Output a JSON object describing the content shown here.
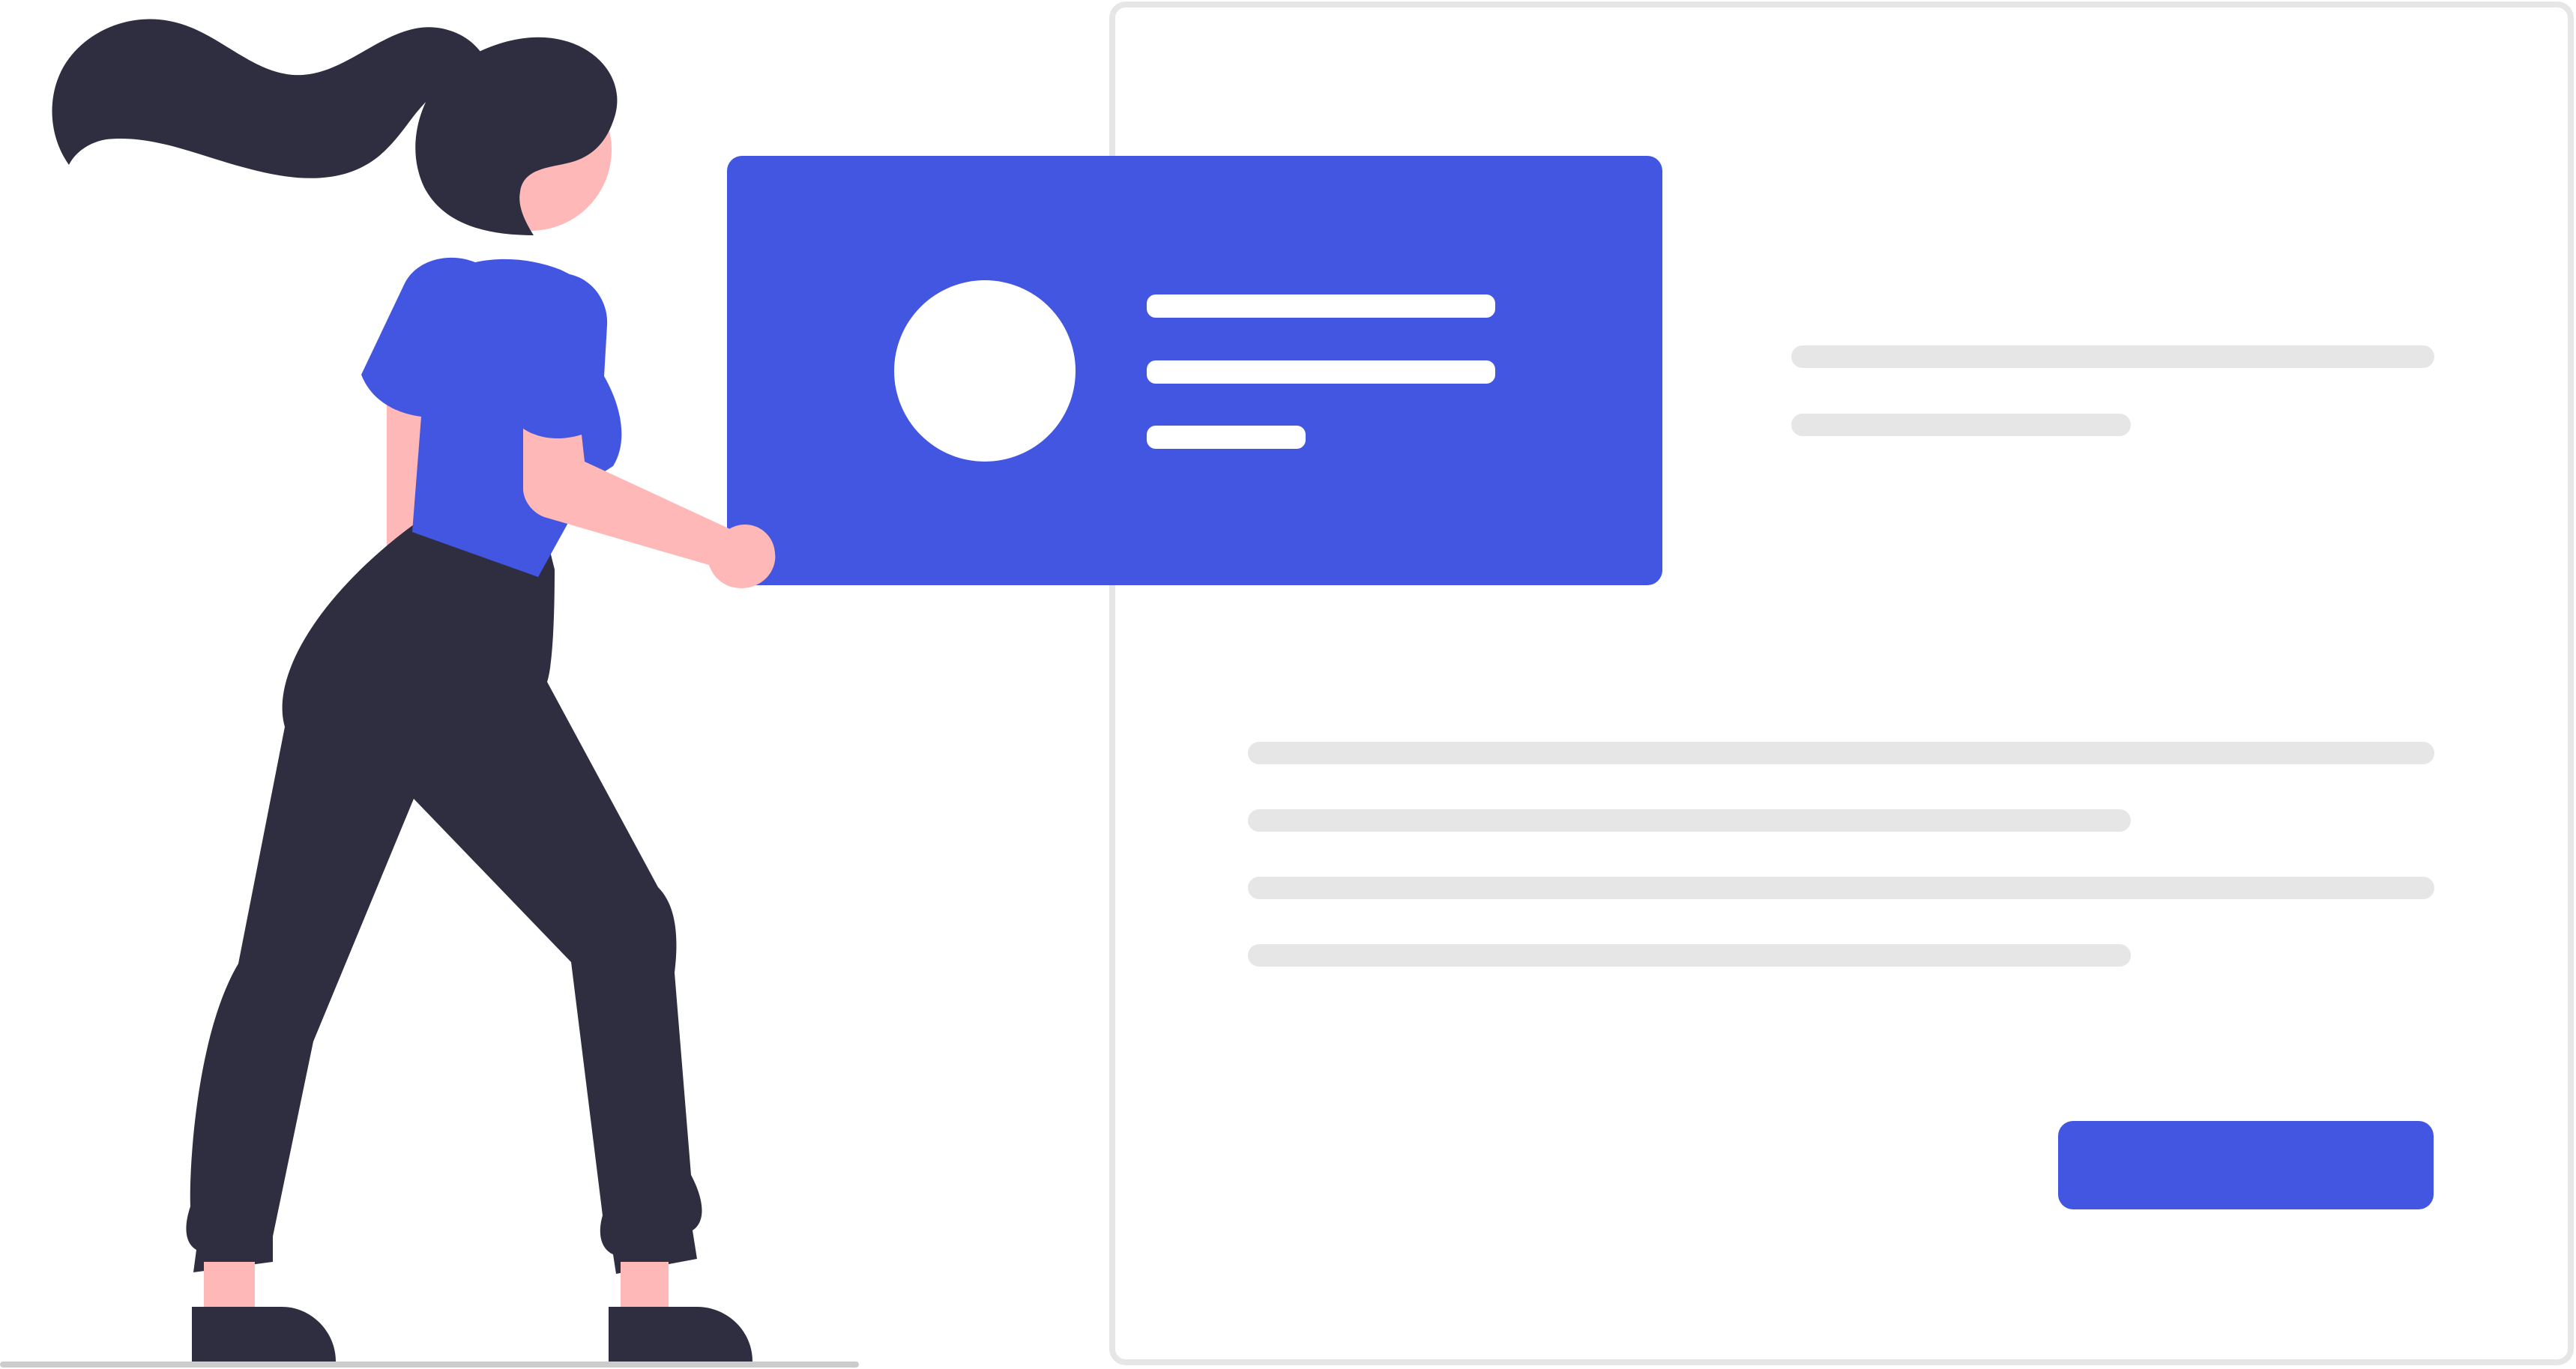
{
  "illustration": {
    "colors": {
      "accent": "#4356E1",
      "dark": "#2F2E41",
      "skin": "#FFB8B8",
      "placeholder": "#E6E6E6",
      "frame_border": "#E6E6E6",
      "ground": "#CCCCCC",
      "white": "#FFFFFF"
    },
    "icons": {
      "person": "woman-figure",
      "avatar": "profile-avatar-icon"
    }
  }
}
